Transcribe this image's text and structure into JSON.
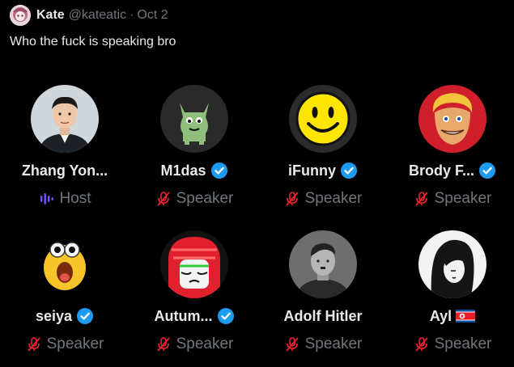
{
  "post": {
    "author_name": "Kate",
    "author_handle": "@kateatic",
    "separator": "·",
    "date": "Oct 2",
    "text": "Who the fuck is speaking bro"
  },
  "colors": {
    "background": "#000000",
    "text": "#e7e9ea",
    "muted": "#71767b",
    "verified": "#1d9bf0",
    "mic_off": "#f4212e",
    "host_bars": "#7856ff"
  },
  "participants": [
    {
      "name": "Zhang Yon...",
      "role": "Host",
      "role_icon": "host-bars-icon",
      "badge": "none"
    },
    {
      "name": "M1das",
      "role": "Speaker",
      "role_icon": "mic-off-icon",
      "badge": "verified"
    },
    {
      "name": "iFunny",
      "role": "Speaker",
      "role_icon": "mic-off-icon",
      "badge": "verified"
    },
    {
      "name": "Brody F...",
      "role": "Speaker",
      "role_icon": "mic-off-icon",
      "badge": "verified"
    },
    {
      "name": "seiya",
      "role": "Speaker",
      "role_icon": "mic-off-icon",
      "badge": "verified"
    },
    {
      "name": "Autum...",
      "role": "Speaker",
      "role_icon": "mic-off-icon",
      "badge": "verified"
    },
    {
      "name": "Adolf Hitler",
      "role": "Speaker",
      "role_icon": "mic-off-icon",
      "badge": "none"
    },
    {
      "name": "Ayl",
      "role": "Speaker",
      "role_icon": "mic-off-icon",
      "badge": "north-korea-flag"
    }
  ]
}
